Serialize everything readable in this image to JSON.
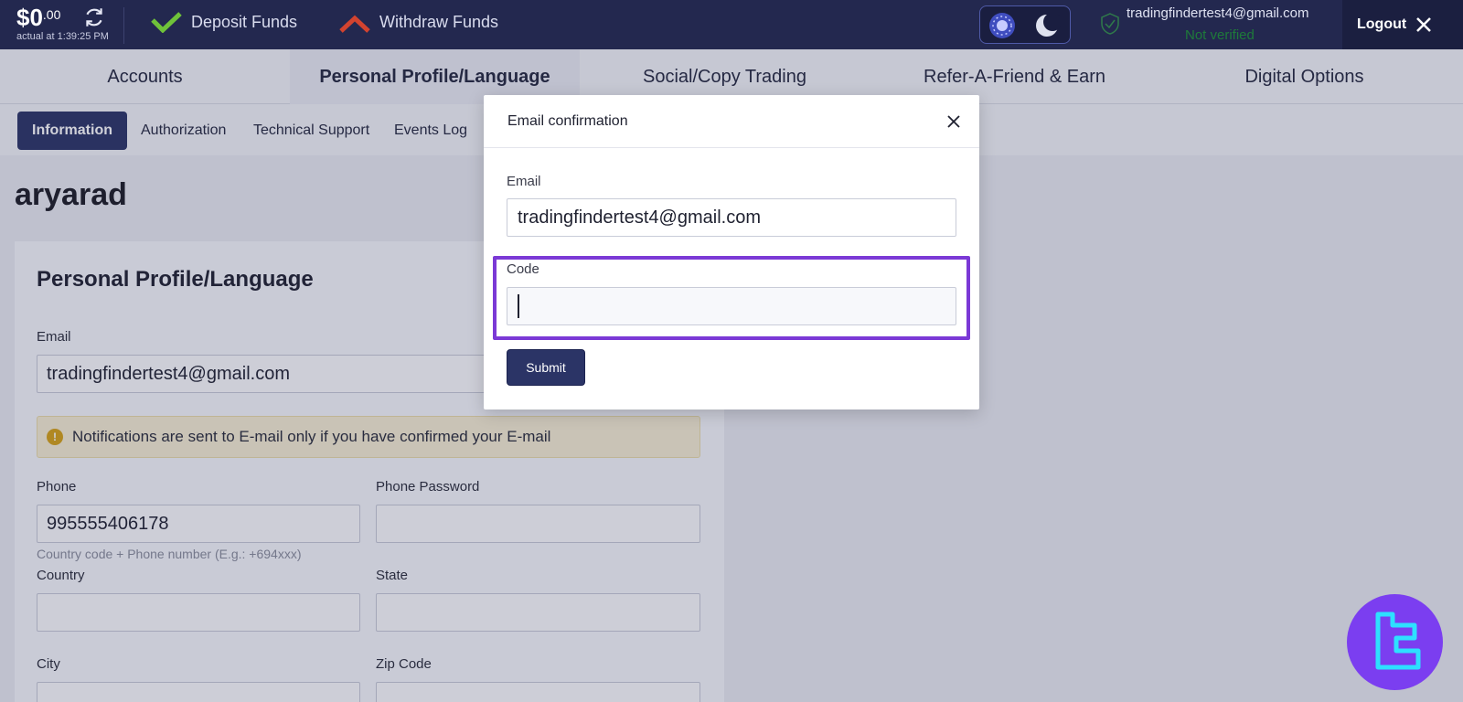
{
  "topbar": {
    "balance_amount": "$0",
    "balance_cents": ".00",
    "balance_sub": "actual at 1:39:25 PM",
    "deposit_label": "Deposit Funds",
    "withdraw_label": "Withdraw Funds",
    "user_email": "tradingfindertest4@gmail.com",
    "user_status": "Not verified",
    "logout_label": "Logout"
  },
  "mainnav": {
    "tabs": [
      {
        "label": "Accounts"
      },
      {
        "label": "Personal Profile/Language"
      },
      {
        "label": "Social/Copy Trading"
      },
      {
        "label": "Refer-A-Friend & Earn"
      },
      {
        "label": "Digital Options"
      }
    ]
  },
  "subnav": {
    "tabs": [
      {
        "label": "Information"
      },
      {
        "label": "Authorization"
      },
      {
        "label": "Technical Support"
      },
      {
        "label": "Events Log"
      }
    ]
  },
  "profile": {
    "username": "aryarad",
    "card_title": "Personal Profile/Language",
    "email_label": "Email",
    "email_value": "tradingfindertest4@gmail.com",
    "notice": "Notifications are sent to E-mail only if you have confirmed your E-mail",
    "phone_label": "Phone",
    "phone_value": "995555406178",
    "phone_hint": "Country code + Phone number (E.g.: +694xxx)",
    "phone_password_label": "Phone Password",
    "country_label": "Country",
    "state_label": "State",
    "city_label": "City",
    "zip_label": "Zip Code"
  },
  "modal": {
    "title": "Email confirmation",
    "email_label": "Email",
    "email_value": "tradingfindertest4@gmail.com",
    "code_label": "Code",
    "code_value": "",
    "submit_label": "Submit"
  },
  "colors": {
    "topbar_bg": "#23284f",
    "accent": "#2b3466",
    "highlight": "#7b39d6",
    "deposit_icon": "#6fc23a",
    "withdraw_icon": "#d2432f"
  }
}
